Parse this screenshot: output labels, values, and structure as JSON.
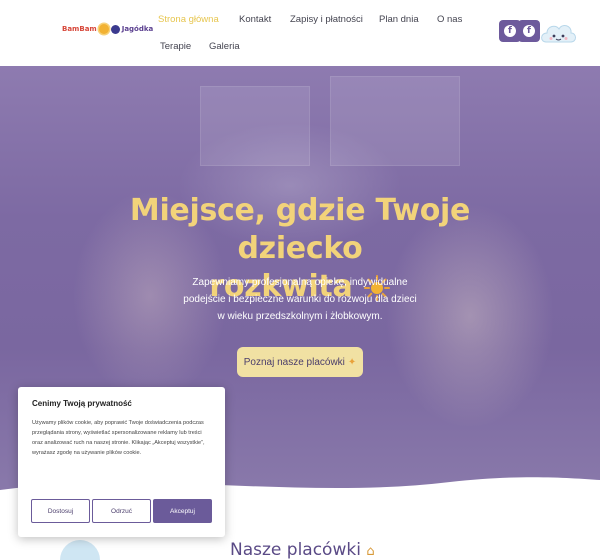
{
  "header": {
    "logo": {
      "part1": "BamBam",
      "part2": "Jagódka"
    },
    "nav": [
      {
        "label": "Strona główna",
        "active": true
      },
      {
        "label": "Kontakt"
      },
      {
        "label": "Zapisy i płatności"
      },
      {
        "label": "Plan dnia"
      },
      {
        "label": "O nas"
      },
      {
        "label": "Terapie"
      },
      {
        "label": "Galeria"
      }
    ],
    "social": [
      {
        "icon": "facebook-icon",
        "glyph": "f"
      },
      {
        "icon": "facebook-icon",
        "glyph": "f"
      }
    ]
  },
  "hero": {
    "title_line1": "Miejsce, gdzie Twoje dziecko",
    "title_line2": "rozkwita",
    "subtitle": "Zapewniamy profesjonalną opiekę, indywidualne podejście i bezpieczne warunki do rozwoju dla dzieci w wieku przedszkolnym i żłobkowym.",
    "cta_label": "Poznaj nasze placówki",
    "cta_icon": "sparkle-icon"
  },
  "cookie": {
    "title": "Cenimy Twoją prywatność",
    "text": "Używamy plików cookie, aby poprawić Twoje doświadczenia podczas przeglądania strony, wyświetlać spersonalizowane reklamy lub treści oraz analizować ruch na naszej stronie. Klikając „Akceptuj wszystkie”, wyrażasz zgodę na używanie plików cookie.",
    "customize": "Dostosuj",
    "reject": "Odrzuć",
    "accept": "Akceptuj"
  },
  "section": {
    "title": "Nasze placówki"
  },
  "colors": {
    "brand_purple": "#6b5b9a",
    "accent_yellow": "#f2d37a",
    "cta_bg": "#f1e1a3"
  }
}
